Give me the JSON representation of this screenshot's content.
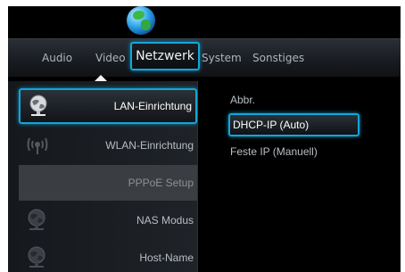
{
  "tabs": [
    {
      "label": "Audio"
    },
    {
      "label": "Video"
    },
    {
      "label": "Netzwerk"
    },
    {
      "label": "System"
    },
    {
      "label": "Sonstiges"
    }
  ],
  "left_menu": [
    {
      "label": "LAN-Einrichtung",
      "icon": "network-globe-icon",
      "state": "selected"
    },
    {
      "label": "WLAN-Einrichtung",
      "icon": "wifi-signal-icon",
      "state": "normal"
    },
    {
      "label": "PPPoE Setup",
      "icon": "",
      "state": "disabled"
    },
    {
      "label": "NAS Modus",
      "icon": "network-globe-icon",
      "state": "normal"
    },
    {
      "label": "Host-Name",
      "icon": "network-globe-icon",
      "state": "normal"
    }
  ],
  "right_options": [
    {
      "label": "Abbr.",
      "state": "normal"
    },
    {
      "label": "DHCP-IP (Auto)",
      "state": "selected"
    },
    {
      "label": "Feste IP (Manuell)",
      "state": "normal"
    }
  ],
  "colors": {
    "accent": "#12a6d8",
    "background": "#000000"
  }
}
